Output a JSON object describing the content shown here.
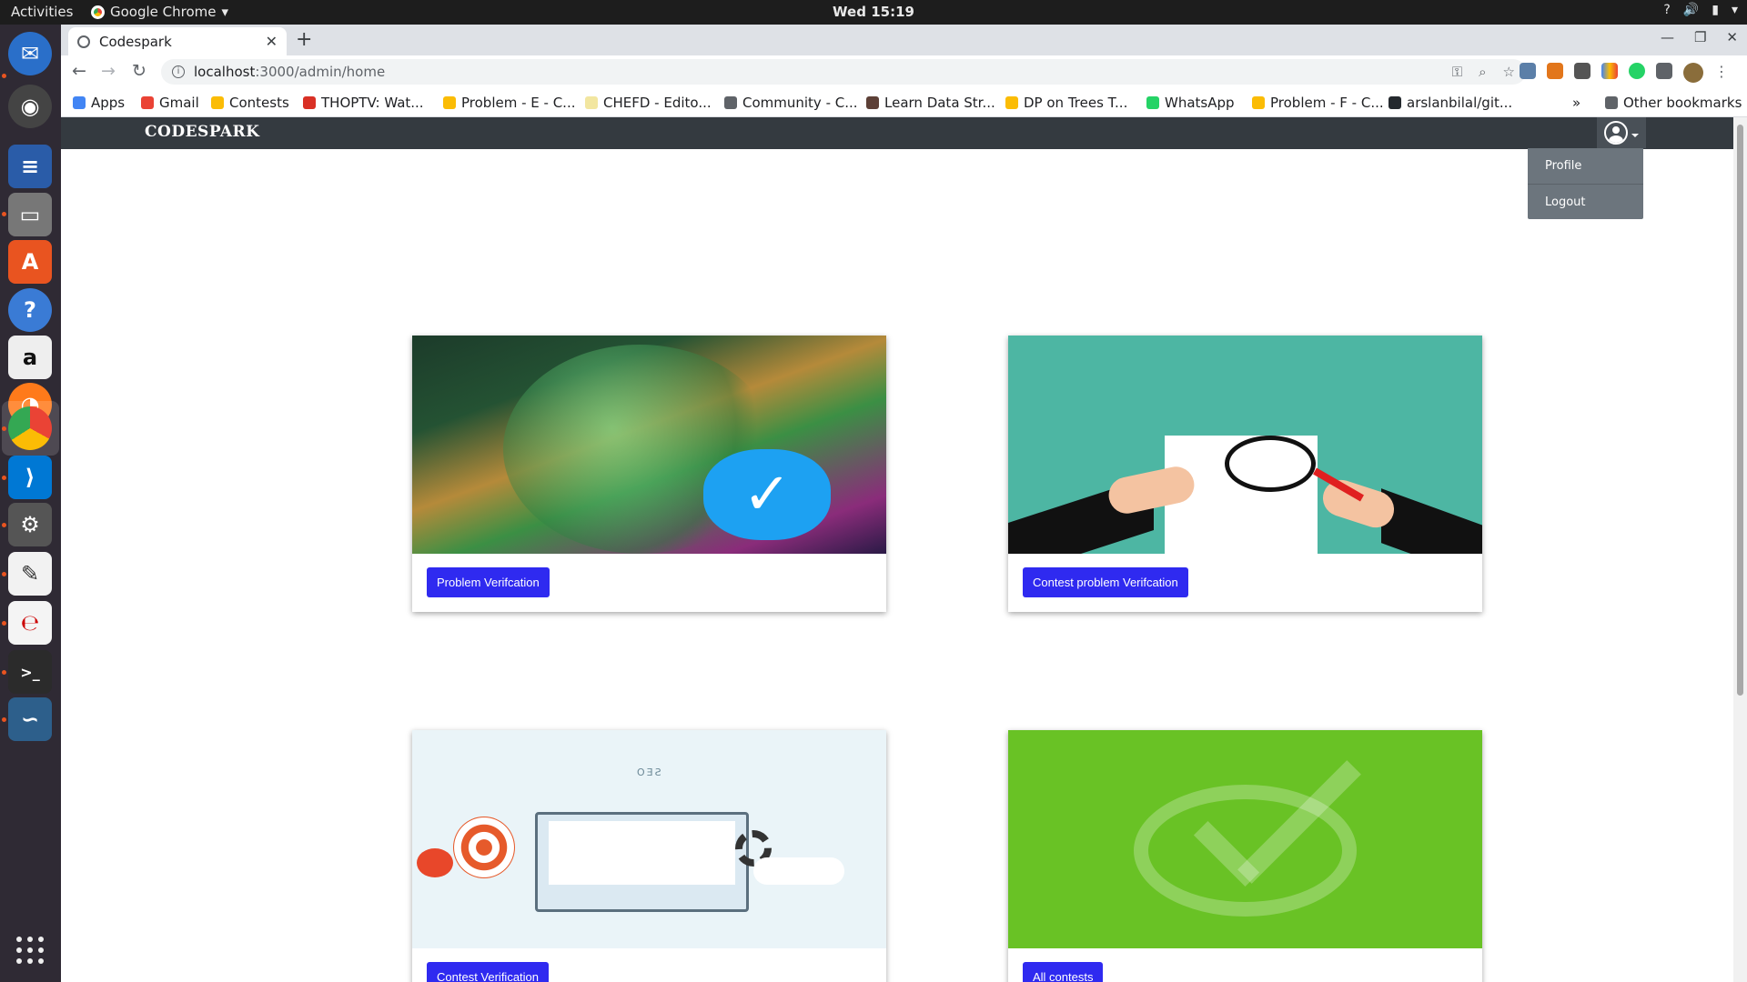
{
  "os": {
    "activities": "Activities",
    "app_name": "Google Chrome",
    "clock": "Wed 15:19"
  },
  "browser": {
    "tab_title": "Codespark",
    "url_host": "localhost",
    "url_path": ":3000/admin/home",
    "bookmarks": [
      {
        "label": "Apps",
        "color": "#4285f4"
      },
      {
        "label": "Gmail",
        "color": "#ea4335"
      },
      {
        "label": "Contests",
        "color": "#fbbc05"
      },
      {
        "label": "THOPTV: Wat...",
        "color": "#d93025"
      },
      {
        "label": "Problem - E - C...",
        "color": "#fbbc05"
      },
      {
        "label": "CHEFD - Edito...",
        "color": "#f2e6a0"
      },
      {
        "label": "Community - C...",
        "color": "#5f6368"
      },
      {
        "label": "Learn Data Str...",
        "color": "#5d4037"
      },
      {
        "label": "DP on Trees T...",
        "color": "#fbbc05"
      },
      {
        "label": "WhatsApp",
        "color": "#25d366"
      },
      {
        "label": "Problem - F - C...",
        "color": "#fbbc05"
      },
      {
        "label": "arslanbilal/git...",
        "color": "#24292e"
      }
    ],
    "other_bookmarks": "Other bookmarks"
  },
  "app": {
    "brand": "CODESPARK",
    "dropdown": [
      "Profile",
      "Logout"
    ],
    "cards": [
      {
        "button": "Problem Verifcation",
        "illustration": "globe-verified"
      },
      {
        "button": "Contest problem Verifcation",
        "illustration": "magnifier-document"
      },
      {
        "button": "Contest Verification",
        "illustration": "seo-analytics"
      },
      {
        "button": "All contests",
        "illustration": "green-check"
      }
    ],
    "seo_text": "SEO",
    "button_color": "#2f2af0",
    "navbar_color": "#343a40"
  }
}
